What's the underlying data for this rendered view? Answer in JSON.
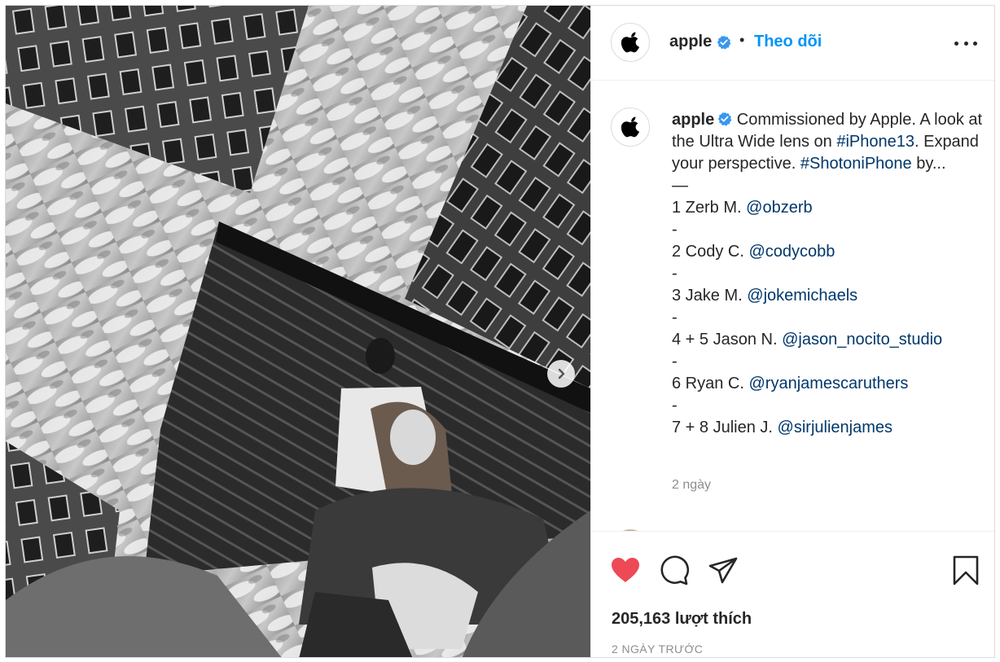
{
  "post": {
    "image_alt": "",
    "next_icon": "chevron-right-icon"
  },
  "header": {
    "username": "apple",
    "verified_icon": "verified-badge-icon",
    "dot": "•",
    "follow_label": "Theo dõi",
    "more_icon": "more-options-icon"
  },
  "caption": {
    "username": "apple",
    "text_1": " Commissioned by Apple. A look at the Ultra Wide lens on ",
    "tag_1": "#iPhone13",
    "text_2": ". Expand your perspective. ",
    "tag_2": "#ShotoniPhone",
    "text_3": " by...",
    "rule": "—",
    "credits": [
      {
        "prefix": "1 Zerb M. ",
        "handle": "@obzerb"
      },
      {
        "prefix": "2 Cody C. ",
        "handle": "@codycobb"
      },
      {
        "prefix": "3 Jake M. ",
        "handle": "@jokemichaels"
      },
      {
        "prefix": "4 + 5 Jason N. ",
        "handle": "@jason_nocito_studio"
      },
      {
        "prefix": "6 Ryan C. ",
        "handle": "@ryanjamescaruthers"
      },
      {
        "prefix": "7 + 8 Julien J. ",
        "handle": "@sirjulienjames"
      }
    ],
    "separator": "-",
    "time": "2 ngày"
  },
  "actions": {
    "like_icon": "heart-filled-icon",
    "comment_icon": "comment-icon",
    "share_icon": "paper-plane-icon",
    "save_icon": "bookmark-icon",
    "like_color": "#ed4956"
  },
  "stats": {
    "likes": "205,163 lượt thích",
    "posted": "2 NGÀY TRƯỚC"
  },
  "colors": {
    "accent": "#0095f6",
    "link": "#00376b",
    "muted": "#8e8e8e"
  }
}
